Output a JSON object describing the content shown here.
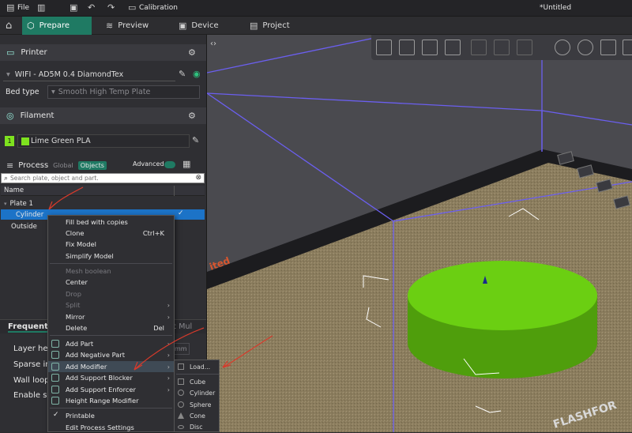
{
  "titlebar": {
    "file": "File",
    "calibration": "Calibration",
    "doc_title": "*Untitled"
  },
  "tabs": [
    {
      "label": "Prepare"
    },
    {
      "label": "Preview"
    },
    {
      "label": "Device"
    },
    {
      "label": "Project"
    }
  ],
  "printer": {
    "header": "Printer",
    "name": "WIFI - AD5M 0.4 DiamondTex",
    "bed_label": "Bed type",
    "bed_value": "Smooth High Temp Plate"
  },
  "filament": {
    "header": "Filament",
    "index": "1",
    "name": "Lime Green PLA",
    "color": "#7ee21f"
  },
  "process": {
    "header": "Process",
    "global": "Global",
    "objects": "Objects",
    "advanced": "Advanced"
  },
  "search": {
    "placeholder": "Search plate, object and part."
  },
  "tree": {
    "col_name": "Name",
    "plate": "Plate 1",
    "object": "Cylinder",
    "outside": "Outside"
  },
  "frequent": {
    "tab": "Frequent",
    "partial_tab": "c Mul",
    "unit": "mm",
    "rows": [
      "Layer hei",
      "Sparse in",
      "Wall loop",
      "Enable su"
    ]
  },
  "context_menu": {
    "items": [
      {
        "label": "Fill bed with copies"
      },
      {
        "label": "Clone",
        "shortcut": "Ctrl+K"
      },
      {
        "label": "Fix Model"
      },
      {
        "label": "Simplify Model"
      },
      {
        "label": "Mesh boolean"
      },
      {
        "label": "Center"
      },
      {
        "label": "Drop"
      },
      {
        "label": "Split"
      },
      {
        "label": "Mirror"
      },
      {
        "label": "Delete",
        "shortcut": "Del"
      },
      {
        "label": "Add Part"
      },
      {
        "label": "Add Negative Part"
      },
      {
        "label": "Add Modifier"
      },
      {
        "label": "Add Support Blocker"
      },
      {
        "label": "Add Support Enforcer"
      },
      {
        "label": "Height Range Modifier"
      },
      {
        "label": "Printable"
      },
      {
        "label": "Edit Process Settings"
      }
    ]
  },
  "submenu": {
    "items": [
      {
        "label": "Load..."
      },
      {
        "label": "Cube"
      },
      {
        "label": "Cylinder"
      },
      {
        "label": "Sphere"
      },
      {
        "label": "Cone"
      },
      {
        "label": "Disc"
      }
    ]
  },
  "viewport": {
    "bed_brand": "FLASHFOR",
    "plate_label": "ited"
  },
  "colors": {
    "accent": "#1f7a63",
    "selection": "#1c73c7",
    "model": "#6bcf12",
    "annotation": "#d83a2b"
  }
}
